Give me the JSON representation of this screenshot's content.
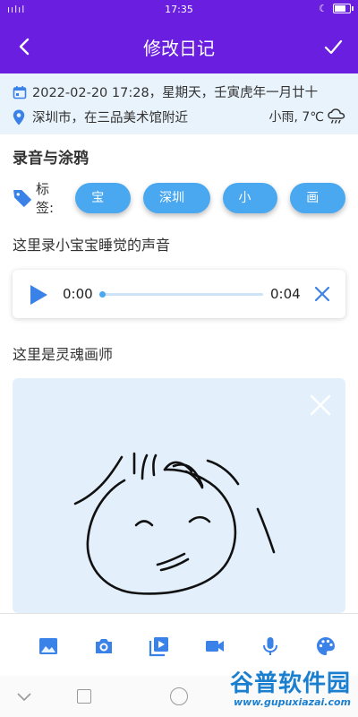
{
  "status_bar": {
    "signal_text": "ıılıl",
    "time": "17:35",
    "battery_level": 0.8
  },
  "app_bar": {
    "title": "修改日记"
  },
  "meta": {
    "datetime": "2022-02-20 17:28，星期天，壬寅虎年一月廿十",
    "location": "深圳市，在三品美术馆附近",
    "weather": "小雨, 7℃"
  },
  "section_title": "录音与涂鸦",
  "tags": {
    "label": "标签:",
    "items": [
      "宝宝",
      "深圳市",
      "小雨",
      "画画"
    ]
  },
  "audio_note": "这里录小宝宝睡觉的声音",
  "audio": {
    "current": "0:00",
    "total": "0:04",
    "progress": 0
  },
  "drawing_note": "这里是灵魂画师",
  "bottom_toolbar": [
    "image-icon",
    "camera-icon",
    "video-library-icon",
    "videocam-icon",
    "mic-icon",
    "palette-icon"
  ],
  "watermark": {
    "cn": "谷普软件园",
    "url": "www.gupuxiazai.com"
  },
  "colors": {
    "primary": "#6a1fe0",
    "accent": "#4aa8f0",
    "icon": "#3a82e8"
  }
}
